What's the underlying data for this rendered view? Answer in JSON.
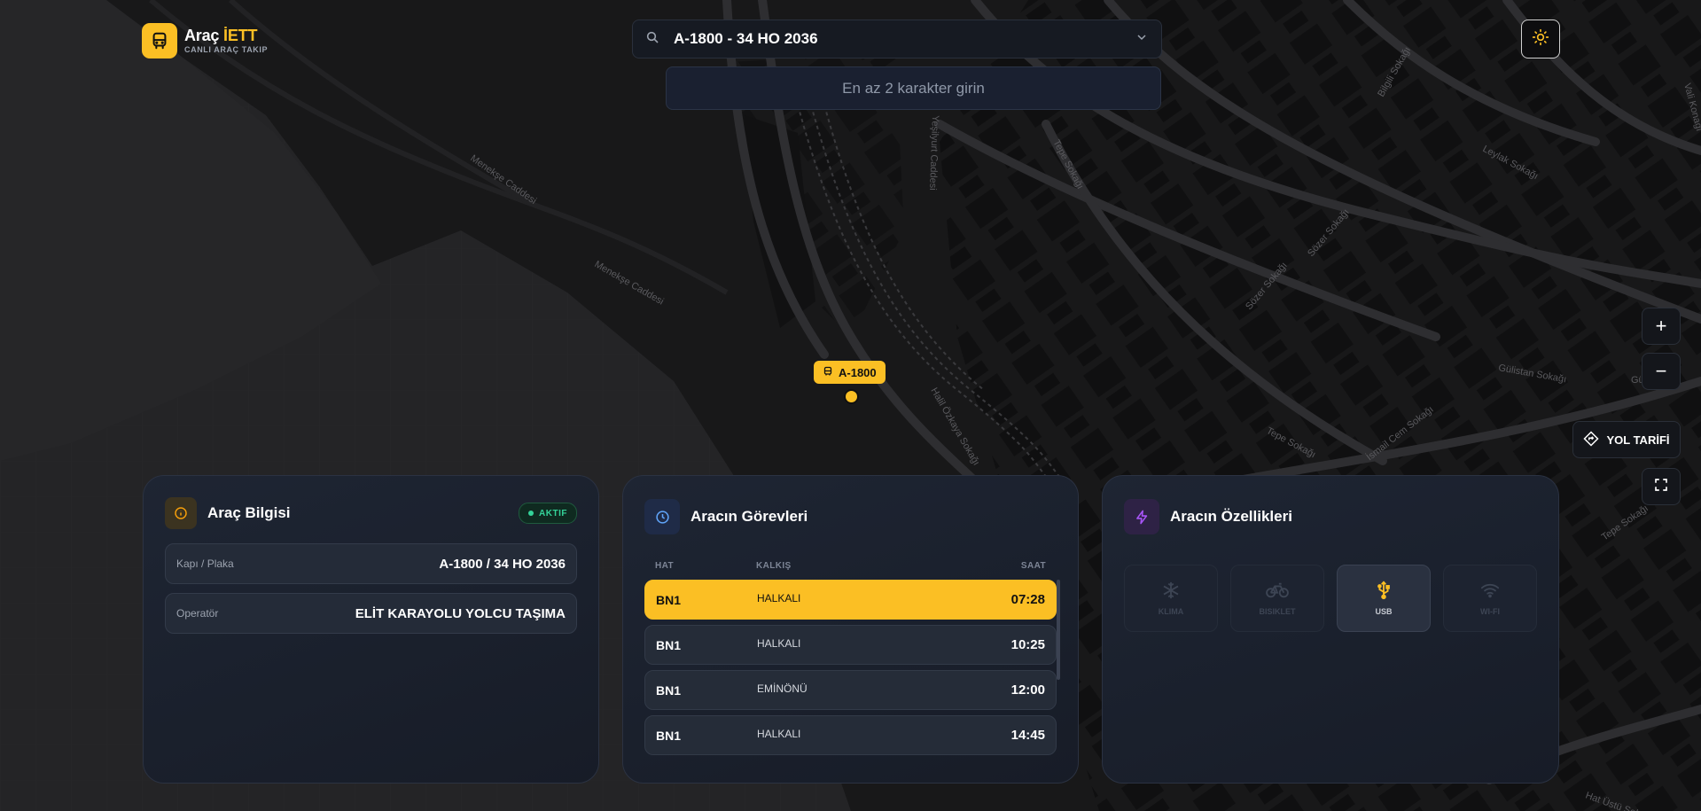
{
  "app": {
    "name": "Araç",
    "name_accent": "İETT",
    "subtitle": "CANLI ARAÇ TAKIP"
  },
  "search": {
    "value": "A-1800 - 34 HO 2036",
    "hint": "En az 2 karakter girin"
  },
  "map": {
    "streets": [
      "Menekşe Caddesi",
      "Menekşe Caddesi",
      "Yeşilyurt Caddesi",
      "Tepe Sokağı",
      "Bilgili Sokağı",
      "Leylak Sokağı",
      "Sözer Sokağı",
      "Sözer Sokağı",
      "Gülistan Sokağı",
      "Gülistan",
      "Tepe Sokağı",
      "İsmail Cem Sokağı",
      "Halil Özkaya Sokağı",
      "Tepe Sokağı",
      "Vali Konağı",
      "Hat Üstü Sok."
    ],
    "vehicle_label": "A-1800",
    "route_button": "YOL TARİFİ"
  },
  "vehicle_info": {
    "title": "Araç Bilgisi",
    "status": "AKTIF",
    "rows": [
      {
        "key": "Kapı / Plaka",
        "value": "A-1800 / 34 HO 2036"
      },
      {
        "key": "Operatör",
        "value": "ELİT KARAYOLU YOLCU TAŞIMA"
      }
    ]
  },
  "tasks": {
    "title": "Aracın Görevleri",
    "columns": {
      "line": "HAT",
      "departure": "KALKIŞ",
      "time": "SAAT"
    },
    "rows": [
      {
        "line": "BN1",
        "departure": "HALKALI",
        "time": "07:28"
      },
      {
        "line": "BN1",
        "departure": "HALKALI",
        "time": "10:25"
      },
      {
        "line": "BN1",
        "departure": "EMİNÖNÜ",
        "time": "12:00"
      },
      {
        "line": "BN1",
        "departure": "HALKALI",
        "time": "14:45"
      }
    ]
  },
  "features": {
    "title": "Aracın Özellikleri",
    "items": [
      {
        "label": "KLIMA",
        "icon": "snowflake-icon",
        "enabled": false
      },
      {
        "label": "BISIKLET",
        "icon": "bicycle-icon",
        "enabled": false
      },
      {
        "label": "USB",
        "icon": "usb-icon",
        "enabled": true
      },
      {
        "label": "WI-FI",
        "icon": "wifi-icon",
        "enabled": false
      }
    ]
  },
  "colors": {
    "accent": "#fbbf24",
    "status_green": "#34d399",
    "info_icon": "#f59e0b",
    "tasks_icon": "#60a5fa",
    "features_icon": "#a855f7"
  }
}
